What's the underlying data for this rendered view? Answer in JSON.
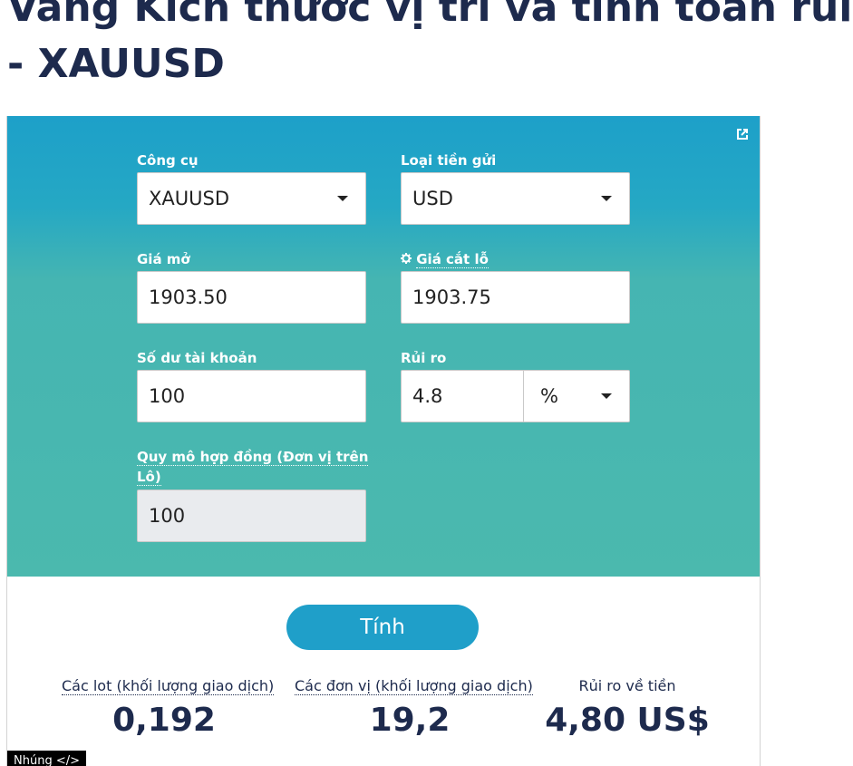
{
  "page": {
    "title_line1": "Vàng Kích thước vị trí và tính toán rủi ro",
    "title_line2": "- XAUUSD"
  },
  "calculator": {
    "open_external_icon": "external-link-icon",
    "instrument": {
      "label": "Công cụ",
      "value": "XAUUSD"
    },
    "deposit_currency": {
      "label": "Loại tiền gửi",
      "value": "USD"
    },
    "open_price": {
      "label": "Giá mở",
      "value": "1903.50"
    },
    "stop_loss_price": {
      "label": "Giá cắt lỗ",
      "icon": "gear-icon",
      "value": "1903.75"
    },
    "account_balance": {
      "label": "Số dư tài khoản",
      "value": "100"
    },
    "risk": {
      "label": "Rủi ro",
      "value": "4.8",
      "unit": "%"
    },
    "contract_size": {
      "label": "Quy mô hợp đồng (Đơn vị trên Lô)",
      "value": "100"
    },
    "calculate_label": "Tính"
  },
  "results": {
    "lots": {
      "label": "Các lot (khối lượng giao dịch)",
      "value": "0,192"
    },
    "units": {
      "label": "Các đơn vị (khối lượng giao dịch)",
      "value": "19,2"
    },
    "money_risk": {
      "label": "Rủi ro về tiền",
      "value": "4,80 US$"
    }
  },
  "embed_label": "Nhúng </>",
  "colors": {
    "header_top": "#1da0c9",
    "header_bottom": "#4bb9ae",
    "button": "#1f9fc9",
    "text_dark": "#1d2a4d"
  }
}
